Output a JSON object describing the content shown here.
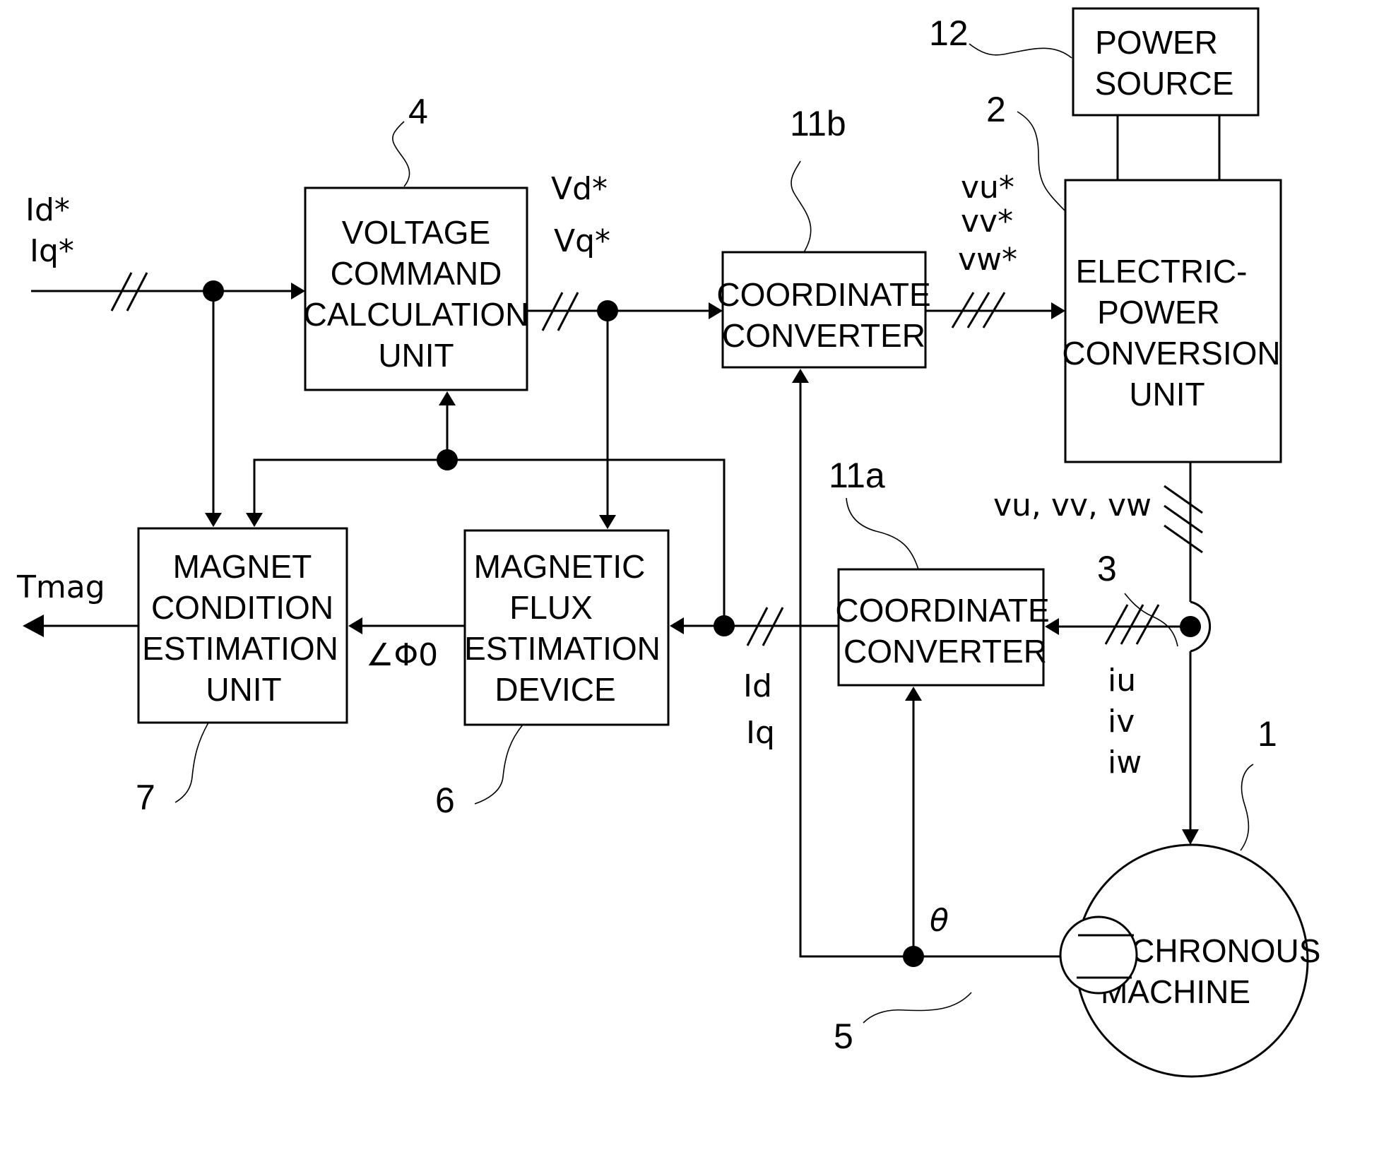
{
  "blocks": {
    "voltage_command": {
      "ref": "4",
      "lines": [
        "VOLTAGE",
        "COMMAND",
        "CALCULATION",
        "UNIT"
      ]
    },
    "coord_converter_b": {
      "ref": "11b",
      "lines": [
        "COORDINATE",
        "CONVERTER"
      ]
    },
    "power_source": {
      "ref": "12",
      "lines": [
        "POWER",
        "SOURCE"
      ]
    },
    "power_conversion": {
      "ref": "2",
      "lines": [
        "ELECTRIC-",
        "POWER",
        "CONVERSION",
        "UNIT"
      ]
    },
    "magnet_condition": {
      "ref": "7",
      "lines": [
        "MAGNET",
        "CONDITION",
        "ESTIMATION",
        "UNIT"
      ]
    },
    "flux_estimation": {
      "ref": "6",
      "lines": [
        "MAGNETIC",
        "FLUX",
        "ESTIMATION",
        "DEVICE"
      ]
    },
    "coord_converter_a": {
      "ref": "11a",
      "lines": [
        "COORDINATE",
        "CONVERTER"
      ]
    },
    "synchronous_machine": {
      "ref": "1",
      "lines": [
        "SYNCHRONOUS",
        "MACHINE"
      ]
    },
    "position_sensor": {
      "ref": "5"
    },
    "current_sensor": {
      "ref": "3"
    }
  },
  "signals": {
    "current_command": [
      "Id*",
      "Iq*"
    ],
    "voltage_command": [
      "Vd*",
      "Vq*"
    ],
    "phase_voltage_command": [
      "vu*",
      "vv*",
      "vw*"
    ],
    "phase_voltage": "vu, vv, vw",
    "phase_current": [
      "iu",
      "iv",
      "iw"
    ],
    "dq_current": [
      "Id",
      "Iq"
    ],
    "flux_phase": "∠Φ0",
    "magnet_temperature": "Tmag",
    "rotor_angle": "θ"
  }
}
